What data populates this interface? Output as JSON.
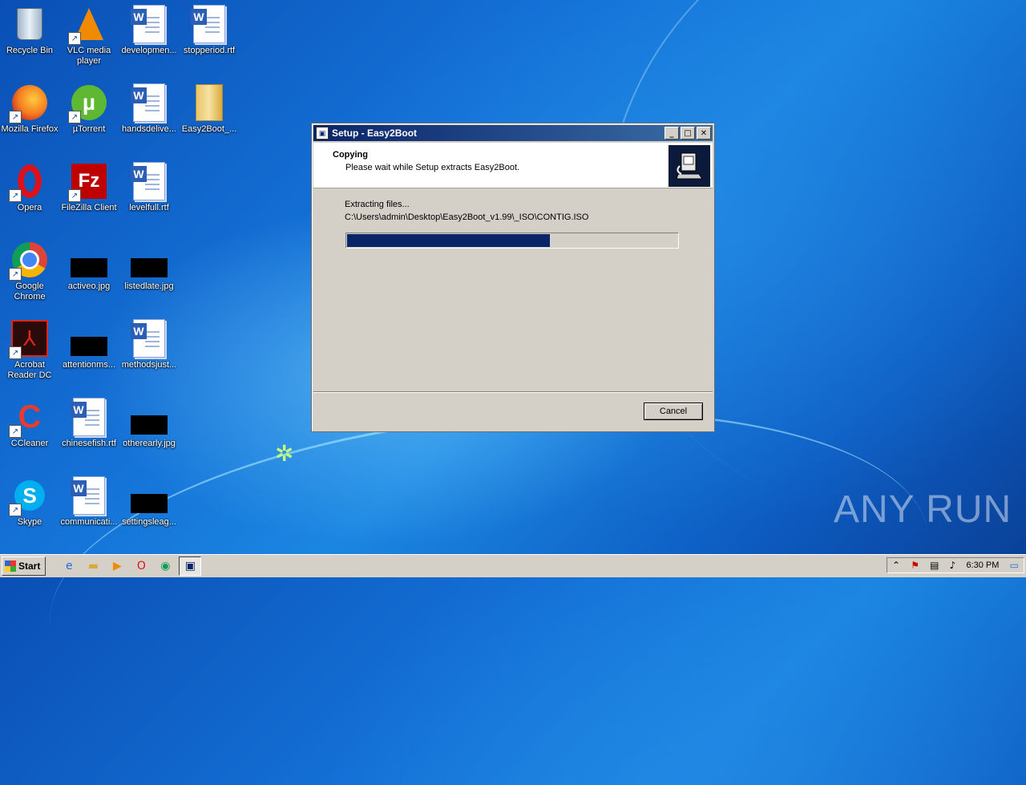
{
  "desktop": {
    "icons": [
      {
        "label": "Recycle Bin"
      },
      {
        "label": "VLC media player"
      },
      {
        "label": "developmen..."
      },
      {
        "label": "stopperiod.rtf"
      },
      {
        "label": "Mozilla Firefox"
      },
      {
        "label": "µTorrent"
      },
      {
        "label": "handsdelive..."
      },
      {
        "label": "Easy2Boot_..."
      },
      {
        "label": "Opera"
      },
      {
        "label": "FileZilla Client"
      },
      {
        "label": "levelfull.rtf"
      },
      {
        "label": "Google Chrome"
      },
      {
        "label": "activeo.jpg"
      },
      {
        "label": "listedlate.jpg"
      },
      {
        "label": "Acrobat Reader DC"
      },
      {
        "label": "attentionms..."
      },
      {
        "label": "methodsjust..."
      },
      {
        "label": "CCleaner"
      },
      {
        "label": "chinesefish.rtf"
      },
      {
        "label": "otherearly.jpg"
      },
      {
        "label": "Skype"
      },
      {
        "label": "communicati..."
      },
      {
        "label": "settingsleag..."
      }
    ]
  },
  "dialog": {
    "title": "Setup - Easy2Boot",
    "header_title": "Copying",
    "header_subtitle": "Please wait while Setup extracts Easy2Boot.",
    "status": "Extracting files...",
    "current_file": "C:\\Users\\admin\\Desktop\\Easy2Boot_v1.99\\_ISO\\CONTIG.ISO",
    "progress_percent": 61,
    "cancel_label": "Cancel",
    "accent": "#0a246a"
  },
  "taskbar": {
    "start_label": "Start",
    "clock": "6:30 PM"
  },
  "watermark": "ANY RUN"
}
